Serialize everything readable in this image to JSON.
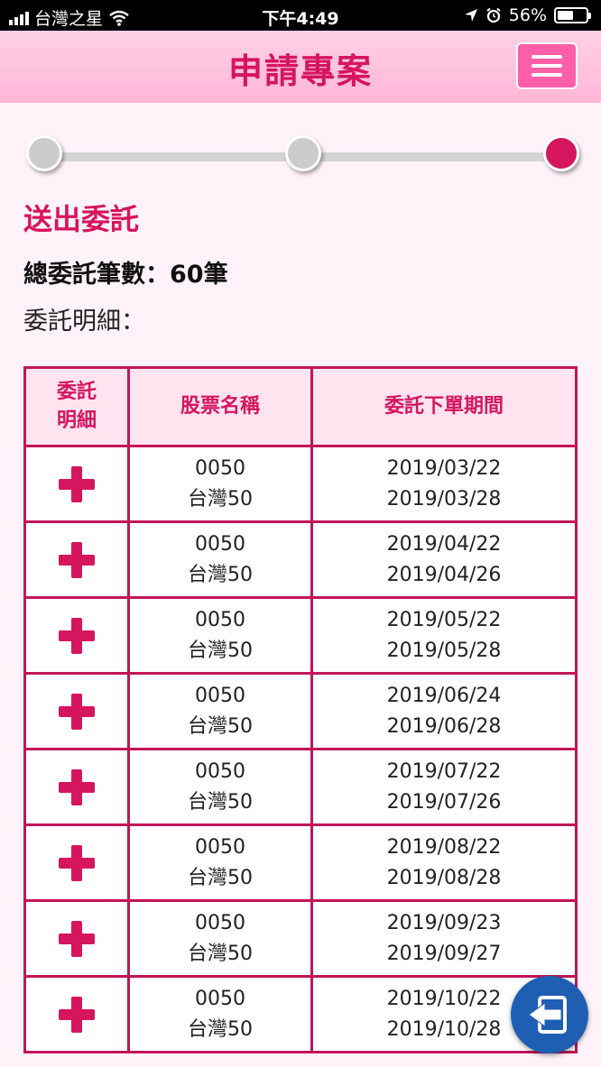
{
  "status_bar": {
    "carrier": "台灣之星",
    "time": "下午4:49",
    "battery": "56%",
    "battery_level": 0.56
  },
  "header": {
    "title": "申請專案",
    "menu_icon": "hamburger-menu-icon"
  },
  "stepper": {
    "steps": 3,
    "active_step": 3,
    "inactive_color": "#cccccc",
    "active_color": "#d6155f"
  },
  "content": {
    "section_title": "送出委託",
    "total_orders": "總委託筆數：60筆",
    "details_label": "委託明細："
  },
  "table": {
    "headers": {
      "detail_line1": "委託",
      "detail_line2": "明細",
      "stock_name": "股票名稱",
      "period": "委託下單期間"
    },
    "rows": [
      {
        "code": "0050",
        "name": "台灣50",
        "start": "2019/03/22",
        "end": "2019/03/28"
      },
      {
        "code": "0050",
        "name": "台灣50",
        "start": "2019/04/22",
        "end": "2019/04/26"
      },
      {
        "code": "0050",
        "name": "台灣50",
        "start": "2019/05/22",
        "end": "2019/05/28"
      },
      {
        "code": "0050",
        "name": "台灣50",
        "start": "2019/06/24",
        "end": "2019/06/28"
      },
      {
        "code": "0050",
        "name": "台灣50",
        "start": "2019/07/22",
        "end": "2019/07/26"
      },
      {
        "code": "0050",
        "name": "台灣50",
        "start": "2019/08/22",
        "end": "2019/08/28"
      },
      {
        "code": "0050",
        "name": "台灣50",
        "start": "2019/09/23",
        "end": "2019/09/27"
      },
      {
        "code": "0050",
        "name": "台灣50",
        "start": "2019/10/22",
        "end": "2019/10/28"
      }
    ]
  },
  "fab": {
    "icon": "exit-icon",
    "color": "#1f5fb3"
  },
  "colors": {
    "accent": "#d6155f",
    "header_bg": "#ffc4de",
    "menu_button": "#ff5fa8"
  }
}
